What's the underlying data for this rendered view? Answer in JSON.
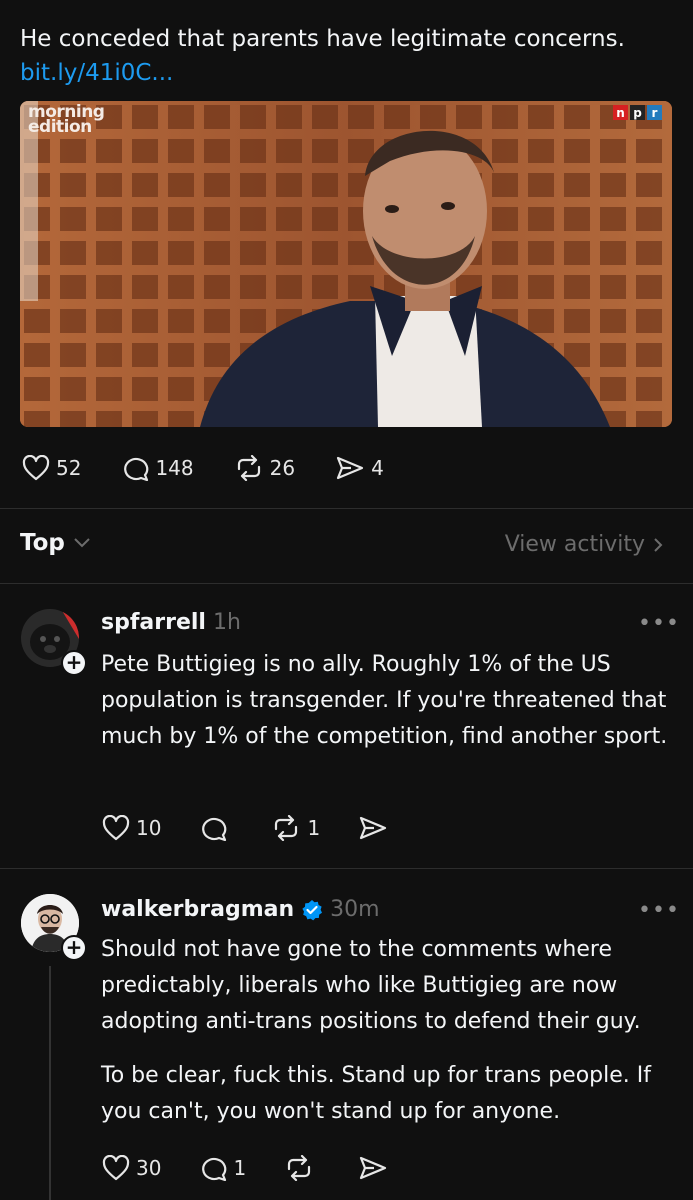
{
  "post": {
    "text": "He conceded that parents have legitimate concerns.",
    "link": "bit.ly/41i0C...",
    "media_logo": "morning\nedition",
    "media_brand": [
      "n",
      "p",
      "r"
    ],
    "actions": {
      "likes": "52",
      "comments": "148",
      "reposts": "26",
      "shares": "4"
    }
  },
  "sort": {
    "label": "Top",
    "view_activity": "View activity"
  },
  "replies": [
    {
      "username": "spfarrell",
      "time": "1h",
      "verified": false,
      "paragraphs": [
        "Pete Buttigieg is no ally. Roughly 1% of the US population is transgender. If you're threatened that much by 1% of the competition, find another sport."
      ],
      "likes": "10",
      "comments": "",
      "reposts": "1"
    },
    {
      "username": "walkerbragman",
      "time": "30m",
      "verified": true,
      "paragraphs": [
        "Should not have gone to the comments where predictably, liberals who like Buttigieg are now adopting anti-trans positions to defend their guy.",
        "To be clear, fuck this. Stand up for trans people. If you can't, you won't stand up for anyone."
      ],
      "likes": "30",
      "comments": "1",
      "reposts": ""
    }
  ],
  "more_label": "•••",
  "colors": {
    "background": "#101010",
    "link": "#1d9bf0",
    "verified": "#0095f6",
    "muted": "#6c6c6c",
    "npr_red": "#d62021",
    "npr_blue": "#237bbd"
  }
}
